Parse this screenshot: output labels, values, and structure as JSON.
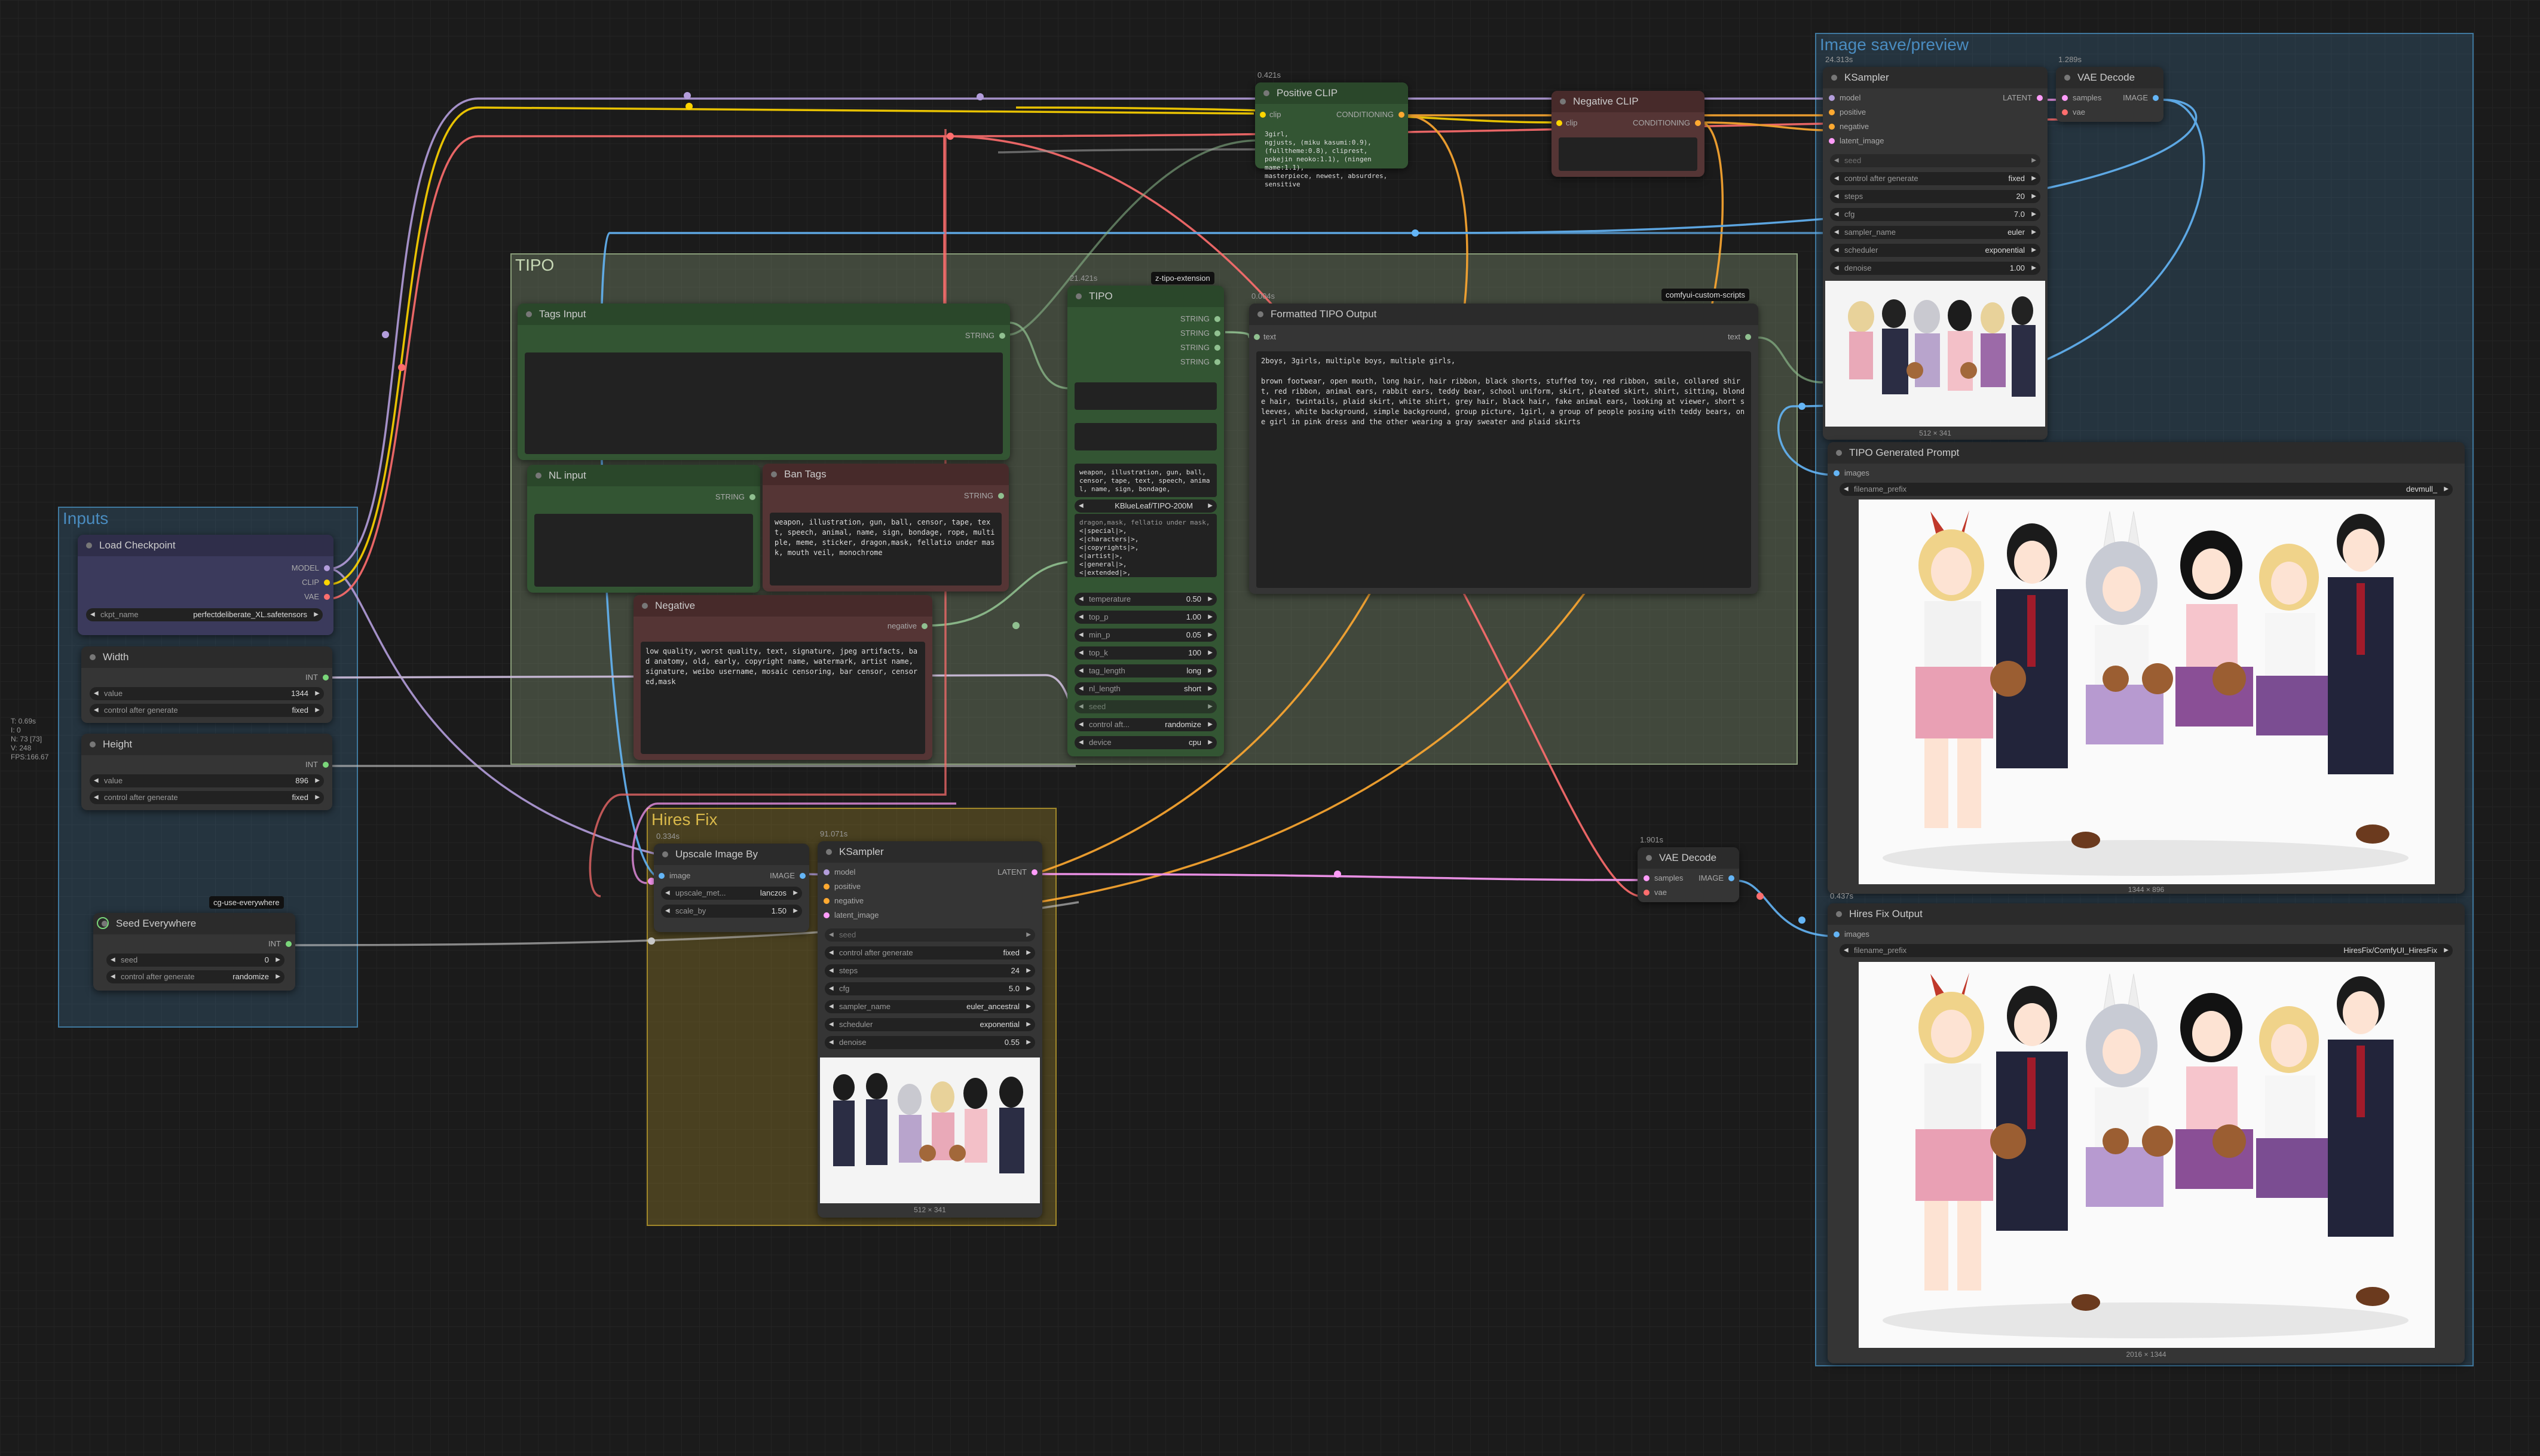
{
  "canvas": {
    "status": [
      "T: 0.69s",
      "I: 0",
      "N: 73 [73]",
      "V: 248",
      "FPS:166.67"
    ]
  },
  "groups": {
    "inputs": "Inputs",
    "tipo": "TIPO",
    "hires": "Hires Fix",
    "save": "Image save/preview"
  },
  "badges": {
    "tipo_ext": "z-tipo-extension",
    "custom_scripts": "comfyui-custom-scripts",
    "cg_use": "cg-use-everywhere"
  },
  "load_checkpoint": {
    "title": "Load Checkpoint",
    "outputs": [
      "MODEL",
      "CLIP",
      "VAE"
    ],
    "widget_label": "ckpt_name",
    "widget_value": "perfectdeliberate_XL.safetensors"
  },
  "width": {
    "title": "Width",
    "output": "INT",
    "value_label": "value",
    "value": "1344",
    "ctrl_label": "control after generate",
    "ctrl_value": "fixed"
  },
  "height": {
    "title": "Height",
    "output": "INT",
    "value_label": "value",
    "value": "896",
    "ctrl_label": "control after generate",
    "ctrl_value": "fixed"
  },
  "seed_everywhere": {
    "title": "Seed Everywhere",
    "output": "INT",
    "seed_label": "seed",
    "seed": "0",
    "ctrl_label": "control after generate",
    "ctrl_value": "randomize"
  },
  "tags_input": {
    "title": "Tags Input",
    "output": "STRING"
  },
  "nl_input": {
    "title": "NL input",
    "output": "STRING"
  },
  "ban_tags": {
    "title": "Ban Tags",
    "output": "STRING",
    "text": "weapon, illustration, gun, ball, censor, tape, text, speech, animal, name, sign, bondage, rope, multiple, meme, sticker, dragon,mask, fellatio under mask, mouth veil, monochrome"
  },
  "negative": {
    "title": "Negative",
    "output": "negative",
    "text": "low quality, worst quality, text, signature, jpeg artifacts, bad anatomy, old, early, copyright name, watermark, artist name, signature, weibo username, mosaic censoring, bar censor, censored,mask"
  },
  "tipo": {
    "timing": "21.421s",
    "title": "TIPO",
    "outputs": [
      "STRING",
      "STRING",
      "STRING",
      "STRING"
    ],
    "ban_preview": "weapon, illustration, gun, ball, censor, tape, text, speech, animal, name, sign, bondage,",
    "ban_preview2": "dragon,mask, fellatio under mask,",
    "model": "KBlueLeaf/TIPO-200M",
    "format_preview": "<|special|>,\n<|characters|>,\n<|copyrights|>,\n<|artist|>,\n<|general|>,\n<|extended|>,\n<|generated|>",
    "widgets": [
      {
        "l": "temperature",
        "v": "0.50"
      },
      {
        "l": "top_p",
        "v": "1.00"
      },
      {
        "l": "min_p",
        "v": "0.05"
      },
      {
        "l": "top_k",
        "v": "100"
      },
      {
        "l": "tag_length",
        "v": "long"
      },
      {
        "l": "nl_length",
        "v": "short"
      }
    ],
    "seed_label": "seed",
    "ctrl_label": "control aft...",
    "ctrl_value": "randomize",
    "device_label": "device",
    "device": "cpu"
  },
  "formatted": {
    "timing": "0.004s",
    "title": "Formatted TIPO Output",
    "output": "text",
    "input": "text",
    "text": "2boys, 3girls, multiple boys, multiple girls,\n\nbrown footwear, open mouth, long hair, hair ribbon, black shorts, stuffed toy, red ribbon, smile, collared shirt, red ribbon, animal ears, rabbit ears, teddy bear, school uniform, skirt, pleated skirt, shirt, sitting, blonde hair, twintails, plaid skirt, white shirt, grey hair, black hair, fake animal ears, looking at viewer, short sleeves, white background, simple background, group picture, 1girl, a group of people posing with teddy bears, one girl in pink dress and the other wearing a gray sweater and plaid skirts"
  },
  "positive_clip": {
    "timing": "0.421s",
    "title": "Positive CLIP",
    "input": "clip",
    "output": "CONDITIONING",
    "text": "3girl,\nngjusts, (miku kasumi:0.9),\n(fulltheme:0.8), cliprest,\npokejin neoko:1.1), (ningen\nmame:1.1),\nmasterpiece, newest, absurdres,\nsensitive"
  },
  "negative_clip": {
    "title": "Negative CLIP",
    "input": "clip",
    "output": "CONDITIONING"
  },
  "ksampler_top": {
    "timing": "24.313s",
    "title": "KSampler",
    "inputs": [
      "model",
      "positive",
      "negative",
      "latent_image"
    ],
    "output": "LATENT",
    "seed_label": "seed",
    "widgets": [
      {
        "l": "control after generate",
        "v": "fixed"
      },
      {
        "l": "steps",
        "v": "20"
      },
      {
        "l": "cfg",
        "v": "7.0"
      },
      {
        "l": "sampler_name",
        "v": "euler"
      },
      {
        "l": "scheduler",
        "v": "exponential"
      },
      {
        "l": "denoise",
        "v": "1.00"
      }
    ],
    "preview_size": "512 × 341"
  },
  "vae_decode_top": {
    "timing": "1.289s",
    "title": "VAE Decode",
    "inputs": [
      "samples",
      "vae"
    ],
    "output": "IMAGE"
  },
  "tipo_generated": {
    "title": "TIPO Generated Prompt",
    "input": "images",
    "prefix_label": "filename_prefix",
    "prefix": "devmull_",
    "size": "1344 × 896"
  },
  "hires_output": {
    "timing": "0.437s",
    "title": "Hires Fix Output",
    "input": "images",
    "prefix_label": "filename_prefix",
    "prefix": "HiresFix/ComfyUI_HiresFix",
    "size": "2016 × 1344"
  },
  "upscale": {
    "timing": "0.334s",
    "title": "Upscale Image By",
    "input": "image",
    "output": "IMAGE",
    "w1l": "upscale_met...",
    "w1v": "lanczos",
    "w2l": "scale_by",
    "w2v": "1.50"
  },
  "ksampler_hires": {
    "timing": "91.071s",
    "title": "KSampler",
    "inputs": [
      "model",
      "positive",
      "negative",
      "latent_image"
    ],
    "output": "LATENT",
    "seed_label": "seed",
    "widgets": [
      {
        "l": "control after generate",
        "v": "fixed"
      },
      {
        "l": "steps",
        "v": "24"
      },
      {
        "l": "cfg",
        "v": "5.0"
      },
      {
        "l": "sampler_name",
        "v": "euler_ancestral"
      },
      {
        "l": "scheduler",
        "v": "exponential"
      },
      {
        "l": "denoise",
        "v": "0.55"
      }
    ],
    "preview_size": "512 × 341"
  },
  "vae_decode_hires": {
    "timing": "1.901s",
    "title": "VAE Decode",
    "inputs": [
      "samples",
      "vae"
    ],
    "output": "IMAGE"
  },
  "colors": {
    "model": "#b39ddb",
    "clip": "#ffd500",
    "vae": "#ff6e6e",
    "conditioning": "#ffa931",
    "latent": "#ff9cf9",
    "image": "#64b5f6",
    "int": "#7ad67a",
    "string": "#90c090",
    "group_inputs": "#3f789e",
    "group_tipo": "#8a9e7a",
    "group_hires": "#a1882a",
    "group_save": "#3f789e"
  }
}
